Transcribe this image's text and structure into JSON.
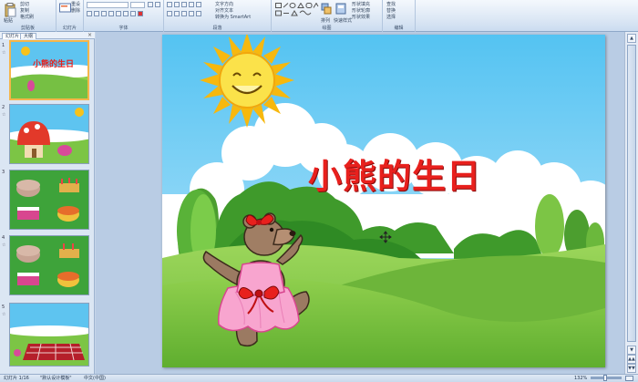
{
  "ribbon": {
    "groups": [
      {
        "id": "clipboard",
        "label": "剪贴板"
      },
      {
        "id": "slides",
        "label": "幻灯片"
      },
      {
        "id": "font",
        "label": "字体"
      },
      {
        "id": "paragraph",
        "label": "段落"
      },
      {
        "id": "drawing",
        "label": "绘图"
      },
      {
        "id": "editing",
        "label": "编辑"
      }
    ],
    "copy_label": "复制",
    "cut_label": "剪切",
    "paste_label": "粘贴",
    "format_painter_label": "格式刷",
    "new_slide_label": "新建幻灯片",
    "reset_label": "重设",
    "delete_label": "删除",
    "text_direction_label": "文字方向",
    "align_text_label": "对齐文本",
    "convert_smartart_label": "转换为 SmartArt",
    "arrange_label": "排列",
    "quick_styles_label": "快速样式",
    "shape_fill_label": "形状填充",
    "shape_outline_label": "形状轮廓",
    "shape_effects_label": "形状效果",
    "find_label": "查找",
    "replace_label": "替换",
    "select_label": "选择"
  },
  "leftpane": {
    "tabs": [
      "幻灯片",
      "大纲"
    ],
    "active_tab": 0,
    "close_glyph": "×",
    "slides": [
      {
        "num": "1",
        "title": "小熊的生日",
        "selected": true
      },
      {
        "num": "2"
      },
      {
        "num": "3"
      },
      {
        "num": "4"
      },
      {
        "num": "5"
      }
    ]
  },
  "slide": {
    "title": "小熊的生日",
    "colors": {
      "title": "#e8201d",
      "sky_top": "#5cc8f4",
      "grass": "#7ac943"
    }
  },
  "statusbar": {
    "slide_counter": "幻灯片 1/16",
    "theme": "\"默认设计模板\"",
    "language": "中文(中国)",
    "zoom": "132%"
  },
  "scrollbar": {
    "up": "▲",
    "down": "▼",
    "prev_page": "▲▲",
    "next_page": "▼▼"
  }
}
